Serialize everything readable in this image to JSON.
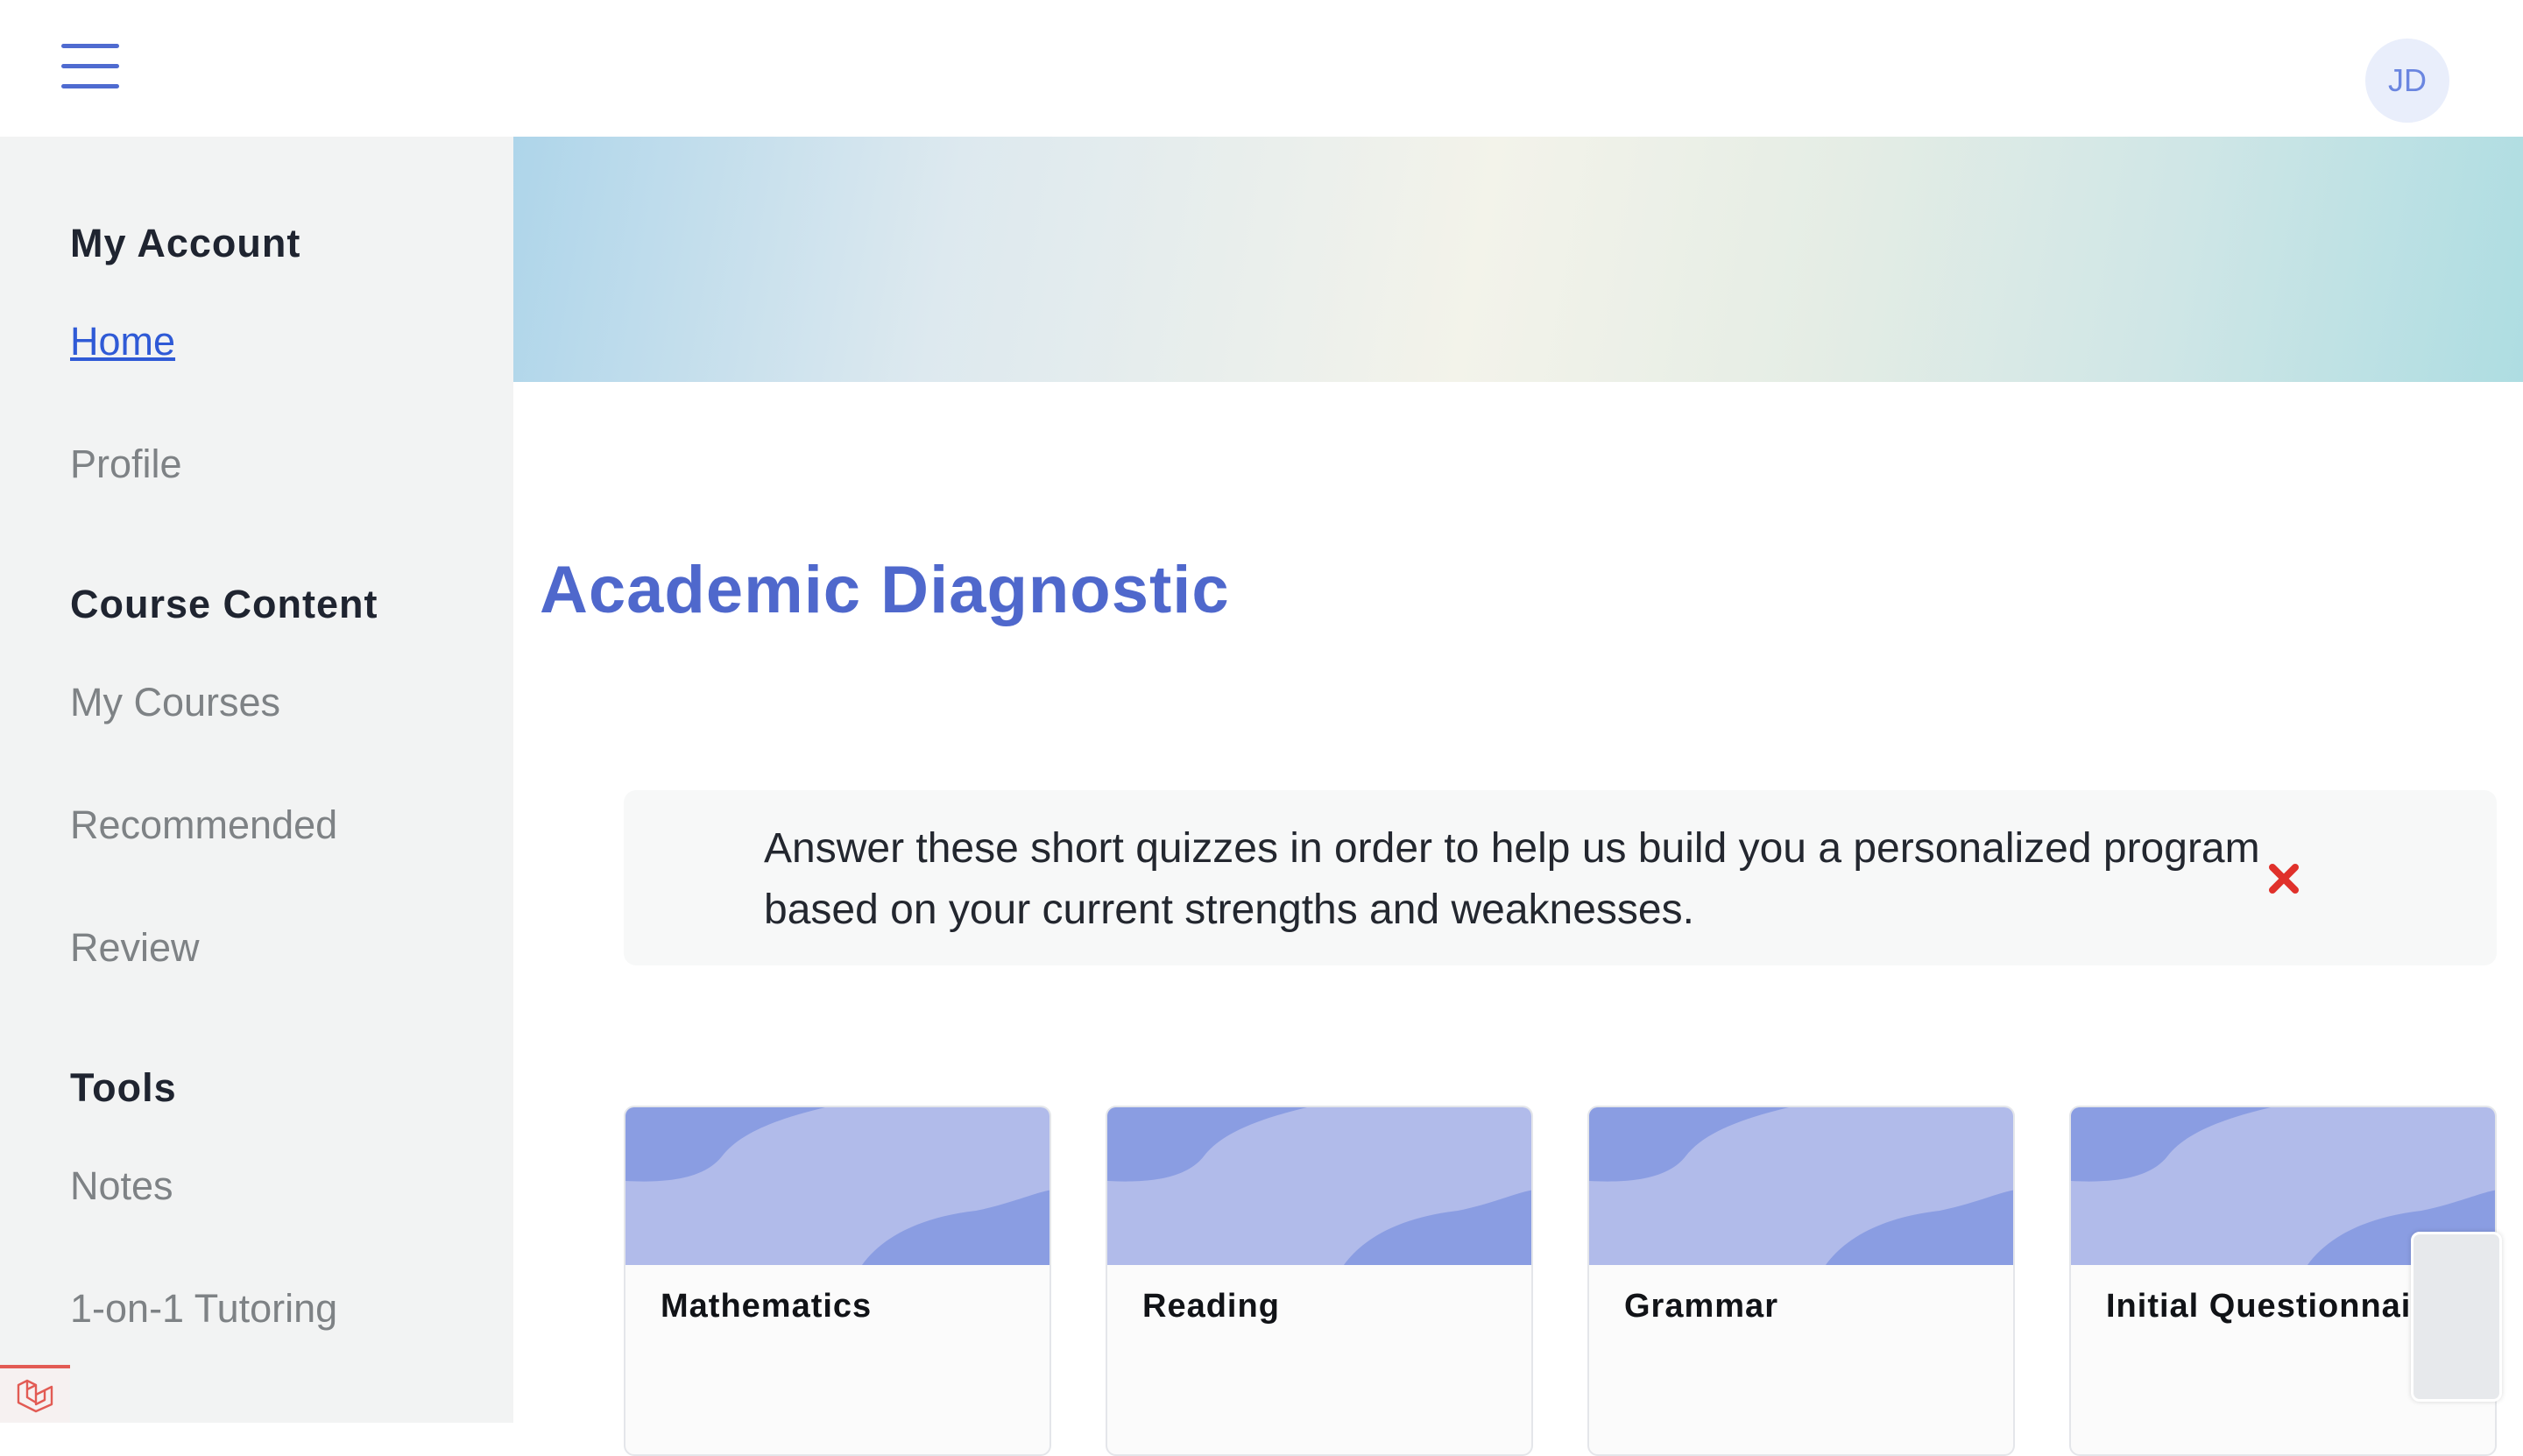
{
  "header": {
    "menu_icon": "hamburger-menu-icon",
    "avatar_initials": "JD",
    "accent_color": "#4f6bd0"
  },
  "sidebar": {
    "sections": [
      {
        "heading": "My Account",
        "items": [
          {
            "label": "Home",
            "active": true
          },
          {
            "label": "Profile",
            "active": false
          }
        ]
      },
      {
        "heading": "Course Content",
        "items": [
          {
            "label": "My Courses",
            "active": false
          },
          {
            "label": "Recommended",
            "active": false
          },
          {
            "label": "Review",
            "active": false
          }
        ]
      },
      {
        "heading": "Tools",
        "items": [
          {
            "label": "Notes",
            "active": false
          },
          {
            "label": "1-on-1 Tutoring",
            "active": false
          }
        ]
      }
    ],
    "badge_icon": "laravel-logo-icon"
  },
  "main": {
    "title": "Academic Diagnostic",
    "notice": {
      "text": "Answer these short quizzes in order to help us build you a personalized program based on your current strengths and weaknesses.",
      "close_icon": "close-icon",
      "close_color": "#e0312b"
    },
    "cards": [
      {
        "title": "Mathematics"
      },
      {
        "title": "Reading"
      },
      {
        "title": "Grammar"
      },
      {
        "title": "Initial Questionnaire"
      }
    ],
    "card_colors": {
      "light": "#b1bbea",
      "dark": "#8a9de2"
    }
  }
}
